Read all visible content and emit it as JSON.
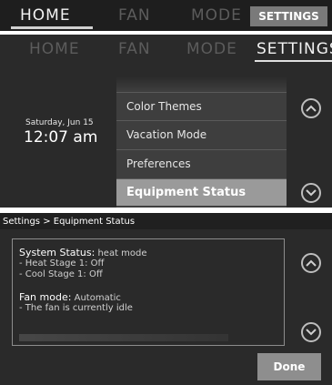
{
  "top_nav": {
    "tabs": [
      {
        "label": "HOME"
      },
      {
        "label": "FAN"
      },
      {
        "label": "MODE"
      },
      {
        "label": "SETTINGS"
      }
    ]
  },
  "settings_screen": {
    "tabs": [
      {
        "label": "HOME"
      },
      {
        "label": "FAN"
      },
      {
        "label": "MODE"
      },
      {
        "label": "SETTINGS"
      }
    ],
    "date": "Saturday, Jun 15",
    "time": "12:07 am",
    "menu_items": [
      {
        "label": "Color Themes"
      },
      {
        "label": "Vacation Mode"
      },
      {
        "label": "Preferences"
      },
      {
        "label": "Equipment Status",
        "selected": true
      }
    ],
    "scroll_up_icon": "chevron-up-icon",
    "scroll_down_icon": "chevron-down-icon"
  },
  "equipment_screen": {
    "breadcrumb": "Settings > Equipment Status",
    "system_status_label": "System Status:",
    "system_status_value": "heat mode",
    "heat_stage": "- Heat Stage 1: Off",
    "cool_stage": "- Cool Stage 1: Off",
    "fan_mode_label": "Fan mode:",
    "fan_mode_value": "Automatic",
    "fan_state": "- The fan is currently idle",
    "done_label": "Done"
  },
  "colors": {
    "background": "#2a2a2a",
    "selected_item": "#9a9a9a",
    "done_button": "#8e8e8e"
  }
}
